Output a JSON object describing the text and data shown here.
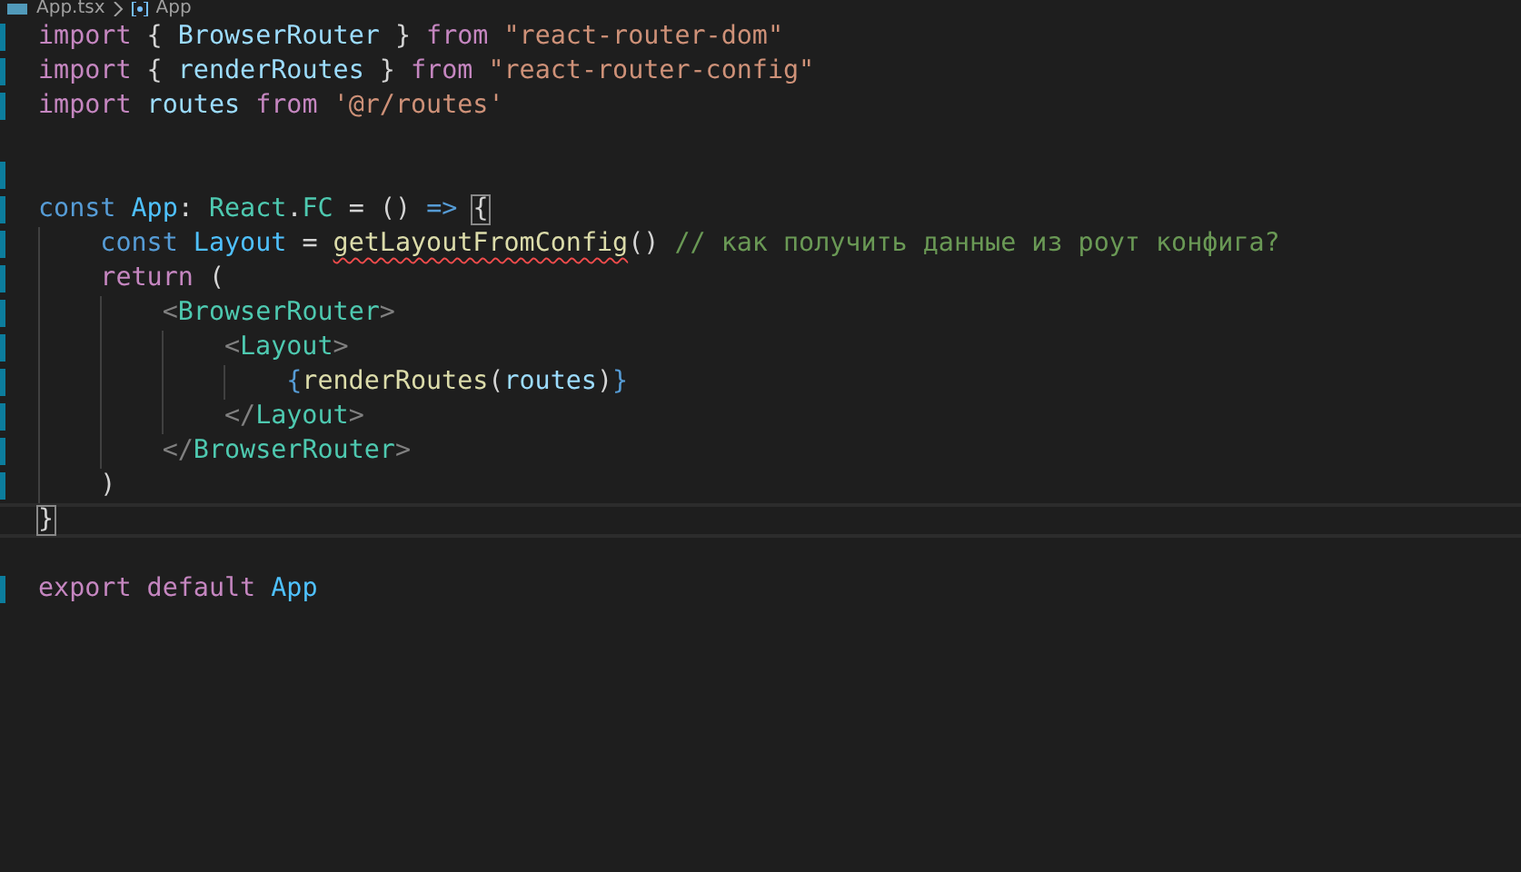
{
  "breadcrumb": {
    "file": "App.tsx",
    "symbol": "App"
  },
  "lines": [
    {
      "changed": true,
      "tokens": [
        {
          "text": "import",
          "kind": "keyword"
        },
        {
          "text": " { ",
          "kind": "punct"
        },
        {
          "text": "BrowserRouter",
          "kind": "variable"
        },
        {
          "text": " } ",
          "kind": "punct"
        },
        {
          "text": "from ",
          "kind": "keyword"
        },
        {
          "text": "\"react-router-dom\"",
          "kind": "string"
        }
      ]
    },
    {
      "changed": true,
      "tokens": [
        {
          "text": "import",
          "kind": "keyword"
        },
        {
          "text": " { ",
          "kind": "punct"
        },
        {
          "text": "renderRoutes",
          "kind": "variable"
        },
        {
          "text": " } ",
          "kind": "punct"
        },
        {
          "text": "from ",
          "kind": "keyword"
        },
        {
          "text": "\"react-router-config\"",
          "kind": "string"
        }
      ]
    },
    {
      "changed": true,
      "tokens": [
        {
          "text": "import ",
          "kind": "keyword"
        },
        {
          "text": "routes ",
          "kind": "variable"
        },
        {
          "text": "from ",
          "kind": "keyword"
        },
        {
          "text": "'@r/routes'",
          "kind": "string"
        }
      ]
    },
    {
      "changed": false
    },
    {
      "changed": true
    },
    {
      "changed": true,
      "tokens": [
        {
          "text": "const ",
          "kind": "storage"
        },
        {
          "text": "App",
          "kind": "constant"
        },
        {
          "text": ": ",
          "kind": "punct"
        },
        {
          "text": "React",
          "kind": "type"
        },
        {
          "text": ".",
          "kind": "punct"
        },
        {
          "text": "FC",
          "kind": "type"
        },
        {
          "text": " = () ",
          "kind": "punct"
        },
        {
          "text": "=> ",
          "kind": "storage"
        },
        {
          "text": "{",
          "kind": "punct",
          "bracket_match": true
        }
      ]
    },
    {
      "changed": true,
      "tokens": [
        {
          "text": "    const ",
          "kind": "storage"
        },
        {
          "text": "Layout",
          "kind": "constant"
        },
        {
          "text": " = ",
          "kind": "punct"
        },
        {
          "text": "getLayoutFromConfig",
          "kind": "function",
          "error": true
        },
        {
          "text": "() ",
          "kind": "punct"
        },
        {
          "text": "// как получить данные из роут конфига?",
          "kind": "comment"
        }
      ]
    },
    {
      "changed": true,
      "tokens": [
        {
          "text": "    return",
          "kind": "keyword"
        },
        {
          "text": " (",
          "kind": "punct"
        }
      ]
    },
    {
      "changed": true,
      "tokens": [
        {
          "text": "        <",
          "kind": "tagbracket"
        },
        {
          "text": "BrowserRouter",
          "kind": "tag"
        },
        {
          "text": ">",
          "kind": "tagbracket"
        }
      ]
    },
    {
      "changed": true,
      "tokens": [
        {
          "text": "            <",
          "kind": "tagbracket"
        },
        {
          "text": "Layout",
          "kind": "tag"
        },
        {
          "text": ">",
          "kind": "tagbracket"
        }
      ]
    },
    {
      "changed": true,
      "tokens": [
        {
          "text": "                {",
          "kind": "storage"
        },
        {
          "text": "renderRoutes",
          "kind": "function"
        },
        {
          "text": "(",
          "kind": "punct"
        },
        {
          "text": "routes",
          "kind": "variable"
        },
        {
          "text": ")",
          "kind": "punct"
        },
        {
          "text": "}",
          "kind": "storage"
        }
      ]
    },
    {
      "changed": true,
      "tokens": [
        {
          "text": "            </",
          "kind": "tagbracket"
        },
        {
          "text": "Layout",
          "kind": "tag"
        },
        {
          "text": ">",
          "kind": "tagbracket"
        }
      ]
    },
    {
      "changed": true,
      "tokens": [
        {
          "text": "        </",
          "kind": "tagbracket"
        },
        {
          "text": "BrowserRouter",
          "kind": "tag"
        },
        {
          "text": ">",
          "kind": "tagbracket"
        }
      ]
    },
    {
      "changed": true,
      "tokens": [
        {
          "text": "    )",
          "kind": "punct"
        }
      ]
    },
    {
      "changed": false,
      "current": true,
      "tokens": [
        {
          "text": "}",
          "kind": "punct",
          "bracket_match": true
        }
      ]
    },
    {
      "changed": false
    },
    {
      "changed": true,
      "tokens": [
        {
          "text": "export default ",
          "kind": "keyword"
        },
        {
          "text": "App",
          "kind": "constant"
        }
      ]
    }
  ]
}
